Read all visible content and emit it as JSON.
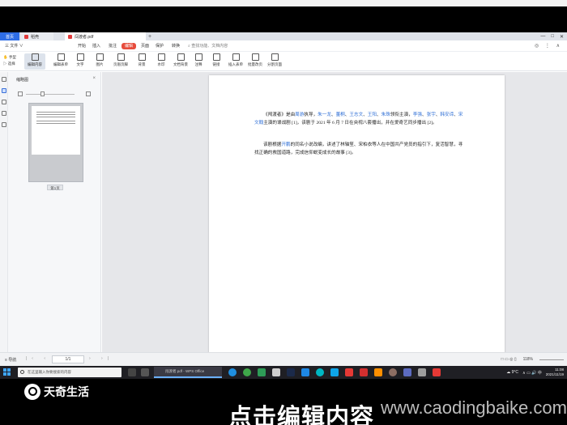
{
  "window": {
    "tabs": [
      {
        "label": "首页"
      },
      {
        "label": "稻壳"
      },
      {
        "label": "闯渡者.pdf"
      }
    ],
    "new_tab": "+",
    "controls": [
      "—",
      "□",
      "✕"
    ]
  },
  "menubar": {
    "file": "三 文件 ∨",
    "items": [
      "开始",
      "插入",
      "批注",
      "编辑",
      "页面",
      "保护",
      "转换"
    ],
    "active": "编辑",
    "search": "查找功能、文档内容",
    "right_icons": "◎ ⋮ ∧"
  },
  "toolbar": {
    "hand": "手型",
    "select": "选择",
    "tools": [
      "编辑内容",
      "编辑表单",
      "文字",
      "图片",
      "页眉页脚",
      "背景",
      "水印",
      "文档背景",
      "注释",
      "链接",
      "插入表单",
      "批量改页",
      "分割页面"
    ]
  },
  "panel": {
    "title": "缩略图",
    "close": "×",
    "page_label": "第1页"
  },
  "document": {
    "p1": [
      {
        "t": "《闯渡者》是由",
        "b": false
      },
      {
        "t": "周游",
        "b": true
      },
      {
        "t": "执导，",
        "b": false
      },
      {
        "t": "朱一龙",
        "b": true
      },
      {
        "t": "、",
        "b": false
      },
      {
        "t": "董桐",
        "b": true
      },
      {
        "t": "、",
        "b": false
      },
      {
        "t": "王志文",
        "b": true
      },
      {
        "t": "、",
        "b": false
      },
      {
        "t": "王阳",
        "b": true
      },
      {
        "t": "、",
        "b": false
      },
      {
        "t": "朱珠",
        "b": true
      },
      {
        "t": "领衔主演，",
        "b": false
      },
      {
        "t": "李强",
        "b": true
      },
      {
        "t": "、",
        "b": false
      },
      {
        "t": "张宇",
        "b": true
      },
      {
        "t": "、",
        "b": false
      },
      {
        "t": "韩安谛",
        "b": true
      },
      {
        "t": "、",
        "b": false
      },
      {
        "t": "宋文翰",
        "b": true
      },
      {
        "t": "主演的谍战剧 [1]，该剧于 2021 年 6 月 7 日在央视八套播出，并在爱奇艺同步播出 [2]。",
        "b": false
      }
    ],
    "p2": [
      {
        "t": "该剧根据",
        "b": false
      },
      {
        "t": "开鹏",
        "b": true
      },
      {
        "t": "的同名小说改编，讲述了林轴笙、宋柏衣等人在中国共产党员的指引下，复活智慧，寻找正确的救国道路，完成信仰蜕变成长的故事 [3]。",
        "b": false
      }
    ]
  },
  "status": {
    "left": "≡ 导航",
    "page_input": "1/1",
    "zoom": "118%",
    "right_icons": "□  ▭  ◎  ▯"
  },
  "taskbar": {
    "search_placeholder": "在这里输入你要搜索的内容",
    "active_window": "闯渡者.pdf - WPS Office",
    "weather": "☁ 9°C",
    "tray_icons": "∧ ▭ 🔊 中",
    "time": "11:08",
    "date": "2021/11/19"
  },
  "overlay": {
    "logo_text": "天奇生活",
    "caption": "点击编辑内容",
    "watermark": "www.caodingbaike.com"
  },
  "colors": {
    "accent_red": "#e74c3c",
    "link_blue": "#2f6fd6",
    "wps_blue": "#2e6de6"
  }
}
